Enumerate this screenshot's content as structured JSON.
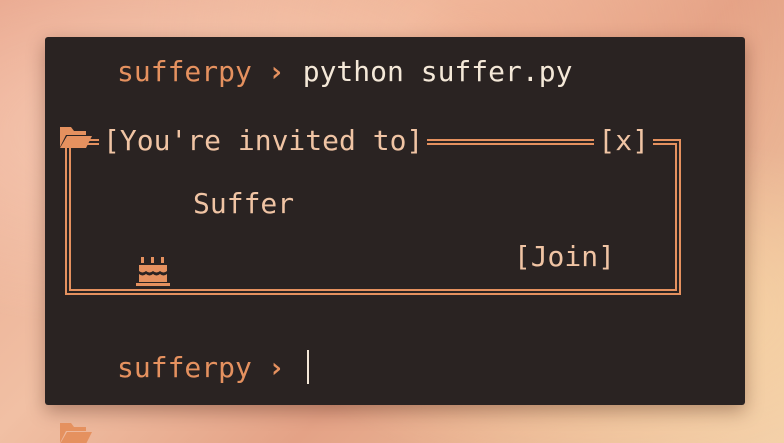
{
  "terminal": {
    "prompt_top": {
      "folder_icon": "folder-open-icon",
      "cwd": "sufferpy",
      "separator": "›",
      "command": "python suffer.py"
    },
    "dialog": {
      "title": "[You're invited to]",
      "close_label": "[x]",
      "event_icon": "cake-icon",
      "event_name": "Suffer",
      "join_label": "[Join]"
    },
    "prompt_bottom": {
      "folder_icon": "folder-open-icon",
      "cwd": "sufferpy",
      "separator": "›",
      "command": ""
    }
  },
  "colors": {
    "terminal_bg": "#2a2322",
    "accent": "#e5915f",
    "text_light": "#f4e8d8",
    "text_peach": "#f0c4a4"
  }
}
